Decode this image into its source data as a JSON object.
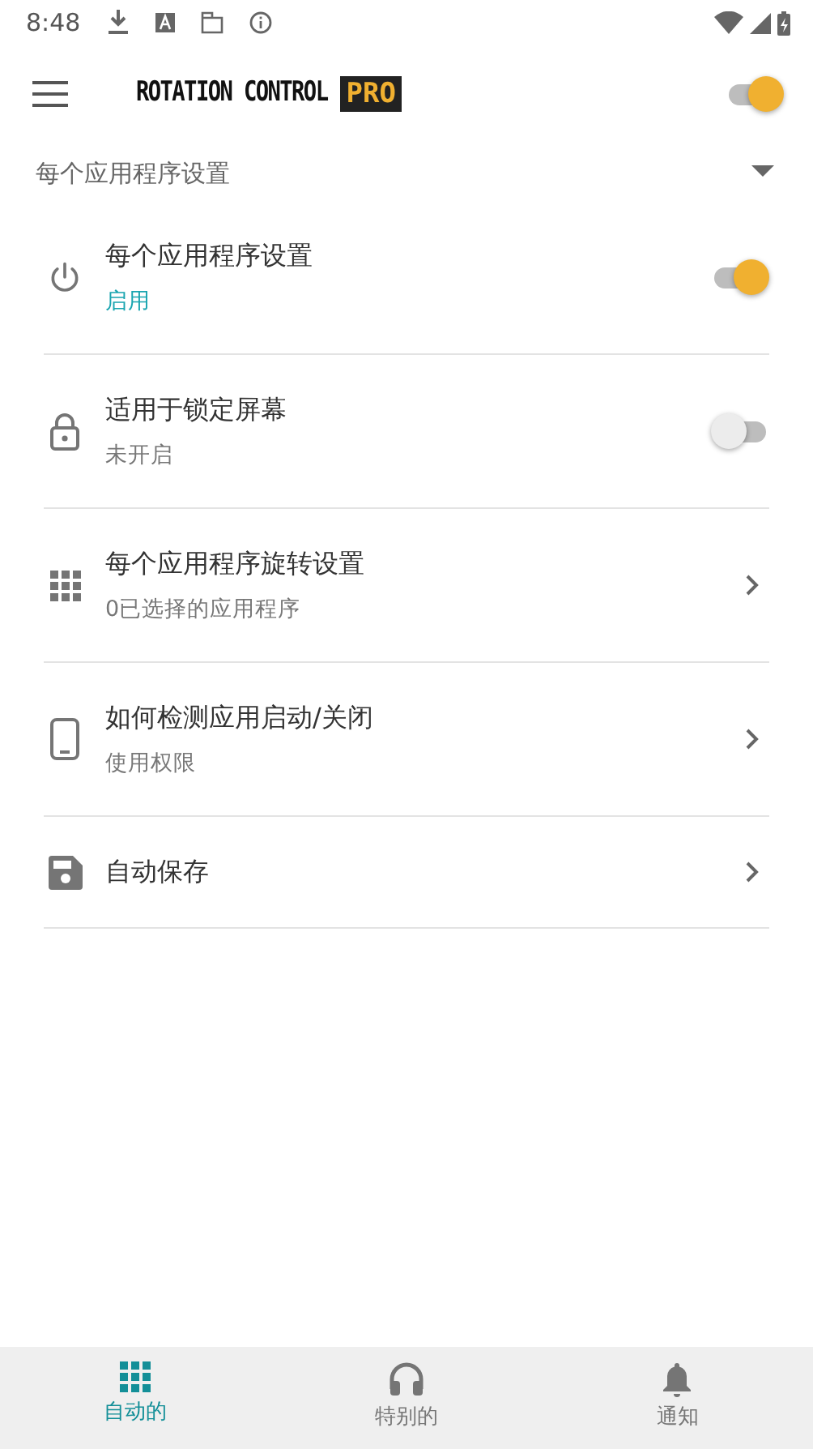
{
  "status_bar": {
    "time": "8:48"
  },
  "app_bar": {
    "logo_text": "ROTATION CONTROL",
    "logo_badge": "PRO",
    "master_switch": {
      "on": true
    }
  },
  "section": {
    "title": "每个应用程序设置",
    "expanded": true
  },
  "items": [
    {
      "kind": "toggle",
      "title": "每个应用程序设置",
      "subtitle": "启用",
      "on": true
    },
    {
      "kind": "toggle",
      "title": "适用于锁定屏幕",
      "subtitle": "未开启",
      "on": false
    },
    {
      "kind": "link",
      "title": "每个应用程序旋转设置",
      "subtitle": "0已选择的应用程序"
    },
    {
      "kind": "link",
      "title": "如何检测应用启动/关闭",
      "subtitle": "使用权限"
    },
    {
      "kind": "link",
      "title": "自动保存"
    }
  ],
  "bottom_nav": [
    {
      "label": "自动的",
      "selected": true
    },
    {
      "label": "特别的",
      "selected": false
    },
    {
      "label": "通知",
      "selected": false
    }
  ]
}
